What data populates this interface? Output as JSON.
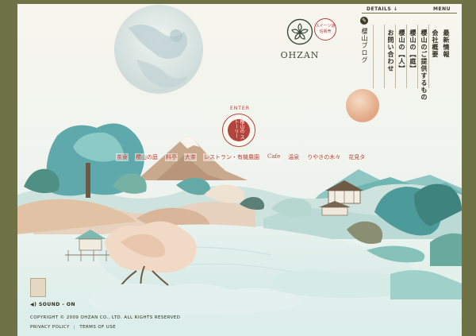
{
  "brand": {
    "logo_text": "OHZAN",
    "sweets_badge": "スイーツ通信販売"
  },
  "header": {
    "details_label": "DETAILS ↓",
    "menu_label": "MENU",
    "blog_label": "櫻山ブログ"
  },
  "menu": {
    "items": [
      "最新情報",
      "会社概要",
      "櫻山のご提供するもの",
      "櫻山の【庭】",
      "櫻山の【人】",
      "お問い合わせ"
    ]
  },
  "enter": {
    "label": "ENTER",
    "badge_text": "櫻山の ストーリー"
  },
  "nav": {
    "items": [
      "茶寮",
      "櫻山の庭",
      "料亭",
      "大茶",
      "レストラン・有機農園",
      "Cafe",
      "温泉",
      "りやきの木々",
      "花見タ"
    ]
  },
  "footer": {
    "sound": "SOUND - ON",
    "copyright": "COPYRIGHT © 2009  OHZAN CO., LTD.  ALL RIGHTS RESERVED",
    "privacy": "PRIVACY POLICY",
    "terms": "TERMS OF USE",
    "separator": "|"
  },
  "colors": {
    "frame": "#6f7246",
    "paper": "#f7f5ee",
    "accent": "#b3443b",
    "teal": "#7fc4c0",
    "ink": "#2b2b1e"
  }
}
